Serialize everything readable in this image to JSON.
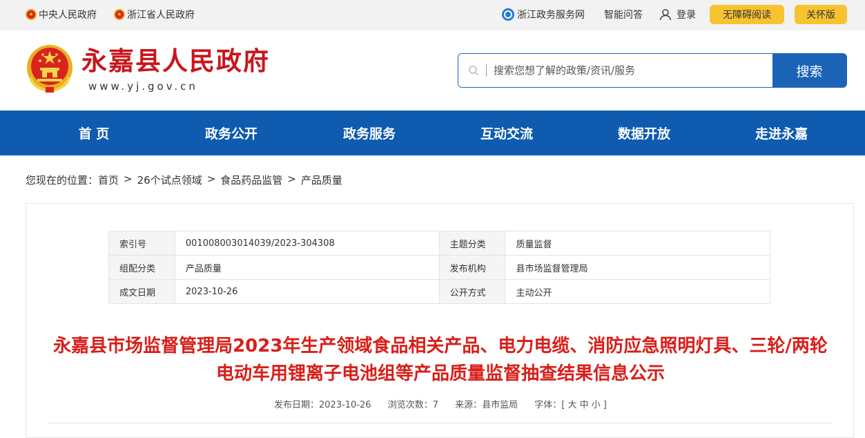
{
  "topbar": {
    "central_gov": "中央人民政府",
    "province_gov": "浙江省人民政府",
    "service_net": "浙江政务服务网",
    "smart_qa": "智能问答",
    "login": "登录",
    "accessible_read": "无障碍阅读",
    "care_mode": "关怀版"
  },
  "header": {
    "site_name": "永嘉县人民政府",
    "site_url": "www.yj.gov.cn",
    "search_placeholder": "搜索您想了解的政策/资讯/服务",
    "search_button": "搜索"
  },
  "nav": {
    "items": [
      "首 页",
      "政务公开",
      "政务服务",
      "互动交流",
      "数据开放",
      "走进永嘉"
    ]
  },
  "breadcrumb": {
    "prefix": "您现在的位置：",
    "items": [
      "首页",
      "26个试点领域",
      "食品药品监管",
      "产品质量"
    ],
    "separator": ">"
  },
  "meta_table": {
    "rows": [
      [
        "索引号",
        "001008003014039/2023-304308",
        "主题分类",
        "质量监督"
      ],
      [
        "组配分类",
        "产品质量",
        "发布机构",
        "县市场监督管理局"
      ],
      [
        "成文日期",
        "2023-10-26",
        "公开方式",
        "主动公开"
      ]
    ]
  },
  "article": {
    "title": "永嘉县市场监督管理局2023年生产领域食品相关产品、电力电缆、消防应急照明灯具、三轮/两轮电动车用锂离子电池组等产品质量监督抽查结果信息公示",
    "publish_date": "发布日期：2023-10-26",
    "views": "浏览次数：7",
    "source": "来源：县市监局",
    "font_size": "字体：[ 大 中 小 ]"
  },
  "colors": {
    "brand_red": "#c8161d",
    "title_red": "#d91e18",
    "nav_blue": "#0e5bb0",
    "button_yellow": "#f7c331"
  }
}
